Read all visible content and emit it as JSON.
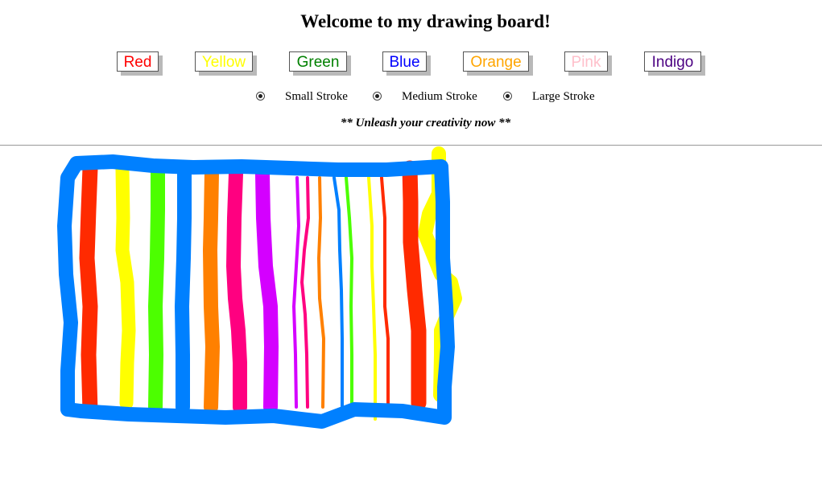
{
  "title": "Welcome to my drawing board!",
  "color_buttons": [
    {
      "label": "Red",
      "color": "#ff0000"
    },
    {
      "label": "Yellow",
      "color": "#ffff00"
    },
    {
      "label": "Green",
      "color": "#008000"
    },
    {
      "label": "Blue",
      "color": "#0000ff"
    },
    {
      "label": "Orange",
      "color": "#ffa500"
    },
    {
      "label": "Pink",
      "color": "#ffc0cb"
    },
    {
      "label": "Indigo",
      "color": "#4b0082"
    }
  ],
  "stroke_options": [
    {
      "label": "Small Stroke"
    },
    {
      "label": "Medium Stroke"
    },
    {
      "label": "Large Stroke"
    }
  ],
  "tagline": "** Unleash your creativity now **",
  "stroke_colors": {
    "red": "#ff2a00",
    "yellow": "#ffff00",
    "green": "#4cff00",
    "blue": "#0080ff",
    "orange": "#ff8000",
    "pink": "#ff0080",
    "purple": "#d400ff"
  }
}
